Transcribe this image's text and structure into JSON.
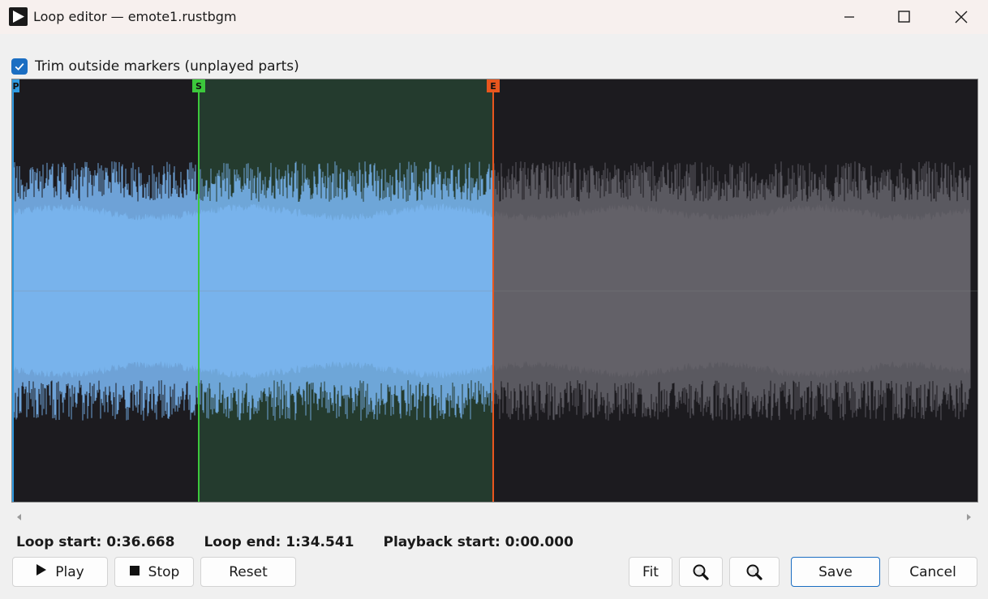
{
  "window": {
    "title": "Loop editor — emote1.rustbgm",
    "controls": [
      "minimize-icon",
      "maximize-icon",
      "close-icon"
    ]
  },
  "trim": {
    "checked": true,
    "label": "Trim outside markers (unplayed parts)"
  },
  "waveform": {
    "markers": [
      {
        "tag": "P",
        "color": "#2f9ae0"
      },
      {
        "tag": "S",
        "color": "#3cc83c"
      },
      {
        "tag": "E",
        "color": "#e8561e"
      }
    ],
    "colors": {
      "background": "#1c1b1f",
      "loop_region": "#243b2e",
      "played_wave": "#78b3ec",
      "trimmed_wave": "#636168"
    }
  },
  "info": {
    "loop_start": "Loop start: 0:36.668",
    "loop_end": "Loop end: 1:34.541",
    "playback_start": "Playback start: 0:00.000"
  },
  "buttons": {
    "play": "Play",
    "stop": "Stop",
    "reset": "Reset",
    "fit": "Fit",
    "save": "Save",
    "cancel": "Cancel",
    "zoom_in_icon": "zoom-in-icon",
    "zoom_out_icon": "zoom-out-icon"
  },
  "accent": "#1b6ec2"
}
